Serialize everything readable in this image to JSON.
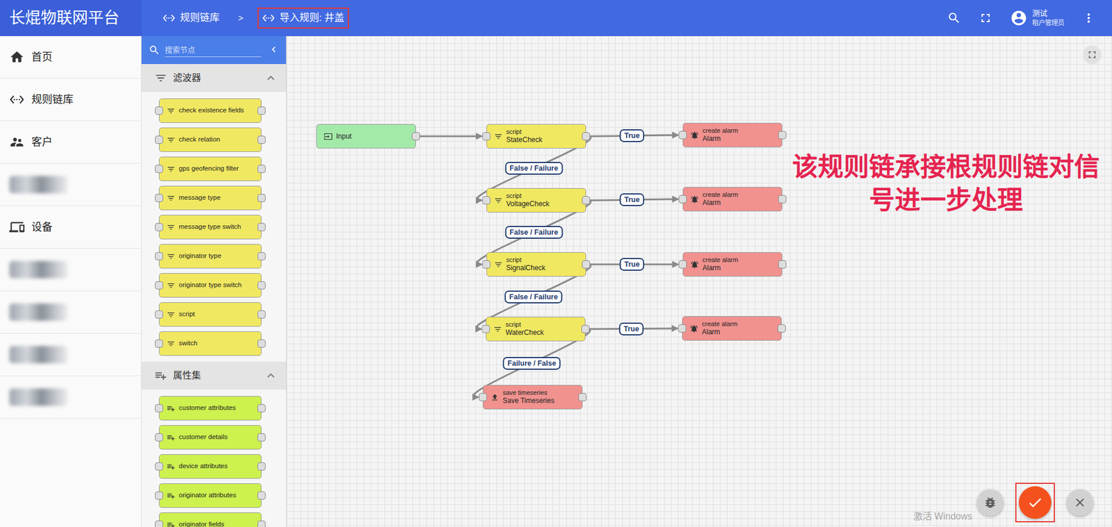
{
  "brand": "长焜物联网平台",
  "breadcrumb": {
    "separator": ">",
    "items": [
      {
        "label": "规则链库",
        "highlighted": false
      },
      {
        "label": "导入规则: 井盖",
        "highlighted": true
      }
    ]
  },
  "user": {
    "name": "测试",
    "role": "租户管理员"
  },
  "sidebar": {
    "items": [
      {
        "label": "首页",
        "kind": "link"
      },
      {
        "label": "规则链库",
        "kind": "link"
      },
      {
        "label": "客户",
        "kind": "link"
      },
      {
        "kind": "blurred"
      },
      {
        "label": "设备",
        "kind": "link"
      },
      {
        "kind": "blurred"
      },
      {
        "kind": "blurred"
      },
      {
        "kind": "blurred"
      },
      {
        "kind": "blurred"
      }
    ]
  },
  "palette": {
    "search": {
      "placeholder": "搜索节点"
    },
    "sections": [
      {
        "title": "滤波器",
        "expanded": true,
        "kind": "filter",
        "nodes": [
          "check existence fields",
          "check relation",
          "gps geofencing filter",
          "message type",
          "message type switch",
          "originator type",
          "originator type switch",
          "script",
          "switch"
        ]
      },
      {
        "title": "属性集",
        "expanded": true,
        "kind": "enrichment",
        "nodes": [
          "customer attributes",
          "customer details",
          "device attributes",
          "originator attributes",
          "originator fields"
        ]
      }
    ]
  },
  "canvas": {
    "nodes": [
      {
        "name": "Input",
        "kind": "input"
      },
      {
        "type": "script",
        "name": "StateCheck",
        "kind": "filter"
      },
      {
        "type": "create alarm",
        "name": "Alarm",
        "kind": "alarm"
      },
      {
        "type": "script",
        "name": "VoltageCheck",
        "kind": "filter"
      },
      {
        "type": "create alarm",
        "name": "Alarm",
        "kind": "alarm"
      },
      {
        "type": "script",
        "name": "SignalCheck",
        "kind": "filter"
      },
      {
        "type": "create alarm",
        "name": "Alarm",
        "kind": "alarm"
      },
      {
        "type": "script",
        "name": "WaterCheck",
        "kind": "filter"
      },
      {
        "type": "create alarm",
        "name": "Alarm",
        "kind": "alarm"
      },
      {
        "type": "save timeseries",
        "name": "Save Timeseries",
        "kind": "storage"
      }
    ],
    "connections": [
      {
        "from": 0,
        "to": 1
      },
      {
        "from": 1,
        "to": 2,
        "label": "True"
      },
      {
        "from": 1,
        "to": 3,
        "label": "False / Failure"
      },
      {
        "from": 3,
        "to": 4,
        "label": "True"
      },
      {
        "from": 3,
        "to": 5,
        "label": "False / Failure"
      },
      {
        "from": 5,
        "to": 6,
        "label": "True"
      },
      {
        "from": 5,
        "to": 7,
        "label": "False / Failure"
      },
      {
        "from": 7,
        "to": 8,
        "label": "True"
      },
      {
        "from": 7,
        "to": 9,
        "label": "Failure / False"
      }
    ],
    "annotation": {
      "lines": [
        "该规则链承接根规则链对信",
        "号进一步处理"
      ]
    }
  },
  "fab_buttons": [
    {
      "disabled": true,
      "highlighted": false
    },
    {
      "disabled": false,
      "highlighted": true
    },
    {
      "disabled": true,
      "highlighted": false
    }
  ],
  "watermark": "激活 Windows"
}
